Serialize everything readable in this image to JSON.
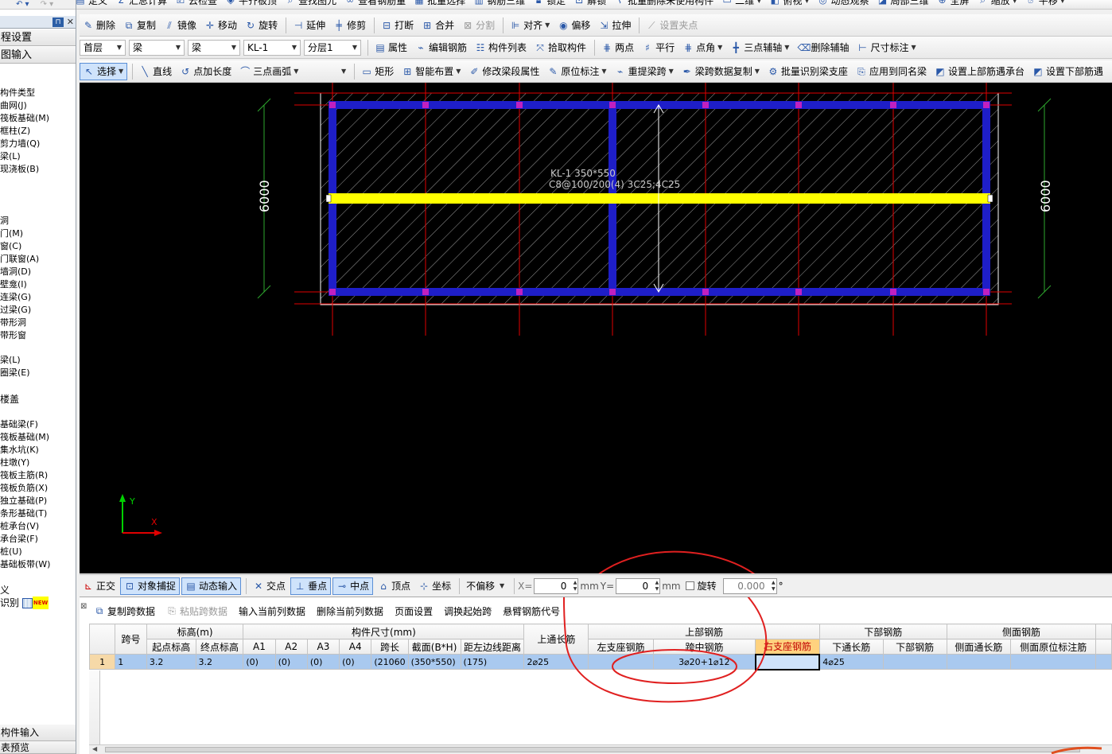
{
  "toolbar_top": [
    "定义",
    "汇总计算",
    "云检查",
    "平齐板顶",
    "查找图元",
    "查看钢筋量",
    "批量选择",
    "钢筋三维",
    "锁定",
    "解锁",
    "批量删除未使用构件",
    "二维",
    "俯视",
    "动态观察",
    "局部三维",
    "全屏",
    "缩放",
    "平移"
  ],
  "toolbar1": {
    "delete": "删除",
    "copy": "复制",
    "mirror": "镜像",
    "move": "移动",
    "rotate": "旋转",
    "extend": "延伸",
    "trim": "修剪",
    "break": "打断",
    "merge": "合并",
    "split": "分割",
    "align": "对齐",
    "offset": "偏移",
    "stretch": "拉伸",
    "set_grip": "设置夹点"
  },
  "toolbar2": {
    "floor": "首层",
    "type": "梁",
    "subtype": "梁",
    "component": "KL-1",
    "layer": "分层1",
    "property": "属性",
    "edit_rebar": "编辑钢筋",
    "component_list": "构件列表",
    "pick": "拾取构件",
    "two_point": "两点",
    "parallel": "平行",
    "point_angle": "点角",
    "three_point_aux": "三点辅轴",
    "delete_aux": "删除辅轴",
    "dimension": "尺寸标注"
  },
  "toolbar3": {
    "select": "选择",
    "line": "直线",
    "point_length": "点加长度",
    "three_point_arc": "三点画弧",
    "rect": "矩形",
    "smart_layout": "智能布置",
    "modify_span": "修改梁段属性",
    "in_situ": "原位标注",
    "reextract_span": "重提梁跨",
    "copy_span_data": "梁跨数据复制",
    "batch_identify": "批量识别梁支座",
    "apply_same": "应用到同名梁",
    "set_top_bearing": "设置上部筋遇承台",
    "set_bottom": "设置下部筋遇"
  },
  "left_panel": {
    "tabs": [
      "程设置",
      "图输入"
    ],
    "items": [
      "构件类型",
      "曲网(J)",
      "筏板基础(M)",
      "框柱(Z)",
      "剪力墙(Q)",
      "梁(L)",
      "现浇板(B)",
      "洞",
      "门(M)",
      "窗(C)",
      "门联窗(A)",
      "墙洞(D)",
      "壁龛(I)",
      "连梁(G)",
      "过梁(G)",
      "带形洞",
      "带形窗",
      "梁(L)",
      "圈梁(E)",
      "楼盖",
      "基础梁(F)",
      "筏板基础(M)",
      "集水坑(K)",
      "柱墩(Y)",
      "筏板主筋(R)",
      "筏板负筋(X)",
      "独立基础(P)",
      "条形基础(T)",
      "桩承台(V)",
      "承台梁(F)",
      "桩(U)",
      "基础板带(W)"
    ],
    "footer": [
      "义",
      "识别"
    ],
    "new_badge": "NEW",
    "bottom_tabs": [
      "构件输入",
      "表预览"
    ]
  },
  "canvas": {
    "beam_label_1": "KL-1 350*550",
    "beam_label_2": "C8@100/200(4) 3C25;4C25",
    "dim_left": "6000",
    "dim_right": "6000",
    "axis_y": "Y",
    "axis_x": "X"
  },
  "statusbar": {
    "ortho": "正交",
    "snap": "对象捕捉",
    "dynamic": "动态输入",
    "intersection": "交点",
    "perpendicular": "垂点",
    "midpoint": "中点",
    "vertex": "顶点",
    "coordinate": "坐标",
    "offset_mode": "不偏移",
    "x_label": "X=",
    "x_value": "0",
    "y_label": "Y=",
    "y_value": "0",
    "unit": "mm",
    "rotate_label": "旋转",
    "rotate_value": "0.000",
    "degree": "°"
  },
  "grid_toolbar": [
    "复制跨数据",
    "粘贴跨数据",
    "输入当前列数据",
    "删除当前列数据",
    "页面设置",
    "调换起始跨",
    "悬臂钢筋代号"
  ],
  "grid": {
    "h1": {
      "span_no": "跨号",
      "elevation": "标高(m)",
      "dims": "构件尺寸(mm)",
      "top_through": "上通长筋",
      "top_rebar": "上部钢筋",
      "bottom_rebar": "下部钢筋",
      "side_rebar": "侧面钢筋"
    },
    "h2": {
      "start_elev": "起点标高",
      "end_elev": "终点标高",
      "a1": "A1",
      "a2": "A2",
      "a3": "A3",
      "a4": "A4",
      "span_len": "跨长",
      "section": "截面(B*H)",
      "edge_dist": "距左边线距离",
      "left_support": "左支座钢筋",
      "mid_span": "跨中钢筋",
      "right_support": "右支座钢筋",
      "bottom_through": "下通长筋",
      "bottom_bar": "下部钢筋",
      "side_through": "侧面通长筋",
      "side_in_situ": "侧面原位标注筋"
    },
    "row": {
      "index": "1",
      "span": "1",
      "start_elev": "3.2",
      "end_elev": "3.2",
      "a1": "(0)",
      "a2": "(0)",
      "a3": "(0)",
      "a4": "(0)",
      "span_len": "(21060",
      "section": "(350*550)",
      "edge_dist": "(175)",
      "top_through": "2⌀25",
      "left_support": "",
      "mid_span": "3⌀20+1⌀12",
      "right_support": "",
      "bottom_through": "4⌀25"
    }
  },
  "colors": {
    "beam_yellow": "#ffff00",
    "frame_blue": "#1e1ec8",
    "node_magenta": "#c020c0",
    "axis_red": "#e00000",
    "annotation_red": "#e02020",
    "header_highlight": "#ffd27f"
  }
}
